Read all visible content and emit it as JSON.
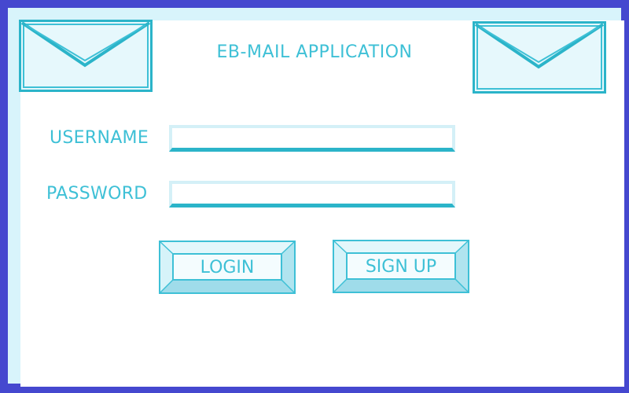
{
  "app": {
    "title": "EB-MAIL APPLICATION"
  },
  "form": {
    "username_label": "USERNAME",
    "username_value": "",
    "password_label": "PASSWORD",
    "password_value": ""
  },
  "buttons": {
    "login_label": "LOGIN",
    "signup_label": "SIGN UP"
  },
  "icons": {
    "left": "envelope-icon",
    "right": "envelope-icon"
  },
  "colors": {
    "frame": "#4548cf",
    "accent": "#3ec0d6",
    "accent_dark": "#2bb4c9",
    "light_fill": "#e6f8fc"
  }
}
